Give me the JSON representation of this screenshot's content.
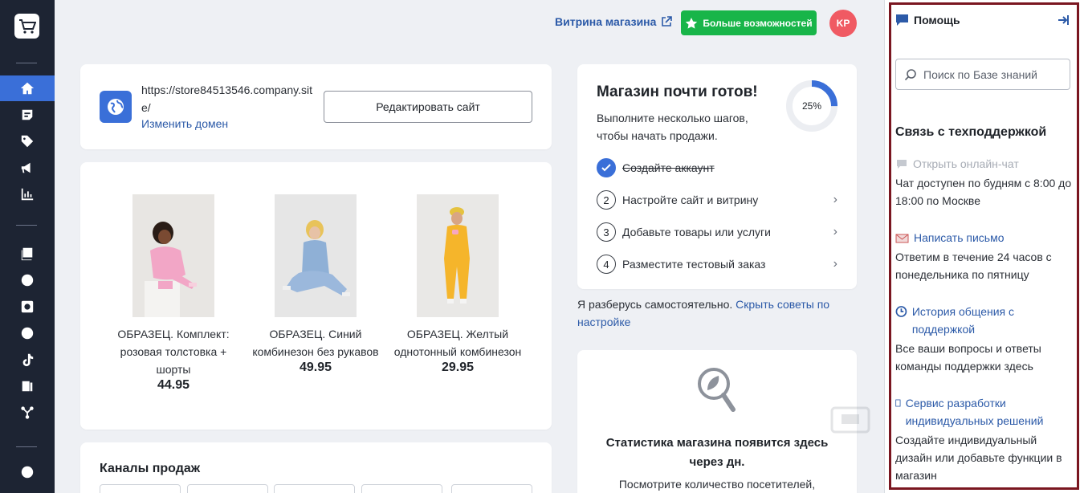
{
  "topbar": {
    "storefront_label": "Витрина магазина",
    "more_label": "Больше возможностей",
    "avatar_initials": "KP"
  },
  "site": {
    "url": "https://store84513546.company.site/",
    "change_domain": "Изменить домен",
    "edit_button": "Редактировать сайт"
  },
  "products": [
    {
      "name": "ОБРАЗЕЦ. Комплект: розовая толстовка + шорты",
      "price": "44.95"
    },
    {
      "name": "ОБРАЗЕЦ. Синий комбинезон без рукавов",
      "price": "49.95"
    },
    {
      "name": "ОБРАЗЕЦ. Желтый однотонный комбинезон",
      "price": "29.95"
    }
  ],
  "channels": {
    "title": "Каналы продаж"
  },
  "ready": {
    "title": "Магазин почти готов!",
    "subtitle": "Выполните несколько шагов, чтобы начать продажи.",
    "progress_label": "25%",
    "progress_fraction": 0.25,
    "steps": [
      {
        "num": "",
        "label": "Создайте аккаунт",
        "done": true
      },
      {
        "num": "2",
        "label": "Настройте сайт и витрину",
        "done": false
      },
      {
        "num": "3",
        "label": "Добавьте товары или услуги",
        "done": false
      },
      {
        "num": "4",
        "label": "Разместите тестовый заказ",
        "done": false
      }
    ]
  },
  "self_help": {
    "text": "Я разберусь самостоятельно.",
    "link": "Скрыть советы по настройке"
  },
  "stats": {
    "title": "Статистика магазина появится здесь через дн.",
    "subtitle": "Посмотрите количество посетителей,"
  },
  "help": {
    "title": "Помощь",
    "search_placeholder": "Поиск по Базе знаний",
    "section_title": "Связь с техподдержкой",
    "chat_link": "Открыть онлайн-чат",
    "chat_text": "Чат доступен по будням с 8:00 до 18:00 по Москве",
    "email_link": "Написать письмо",
    "email_text": "Ответим в течение 24 часов с понедельника по пятницу",
    "history_link": "История общения с поддержкой",
    "history_text": "Все ваши вопросы и ответы команды поддержки здесь",
    "custom_link": "Сервис разработки индивидуальных решений",
    "custom_text": "Создайте индивидуальный дизайн или добавьте функции в магазин"
  },
  "colors": {
    "accent": "#3a6fd8",
    "green": "#18b549",
    "rail": "#1d2433",
    "avatar": "#f05a63",
    "frame": "#7a1620"
  }
}
